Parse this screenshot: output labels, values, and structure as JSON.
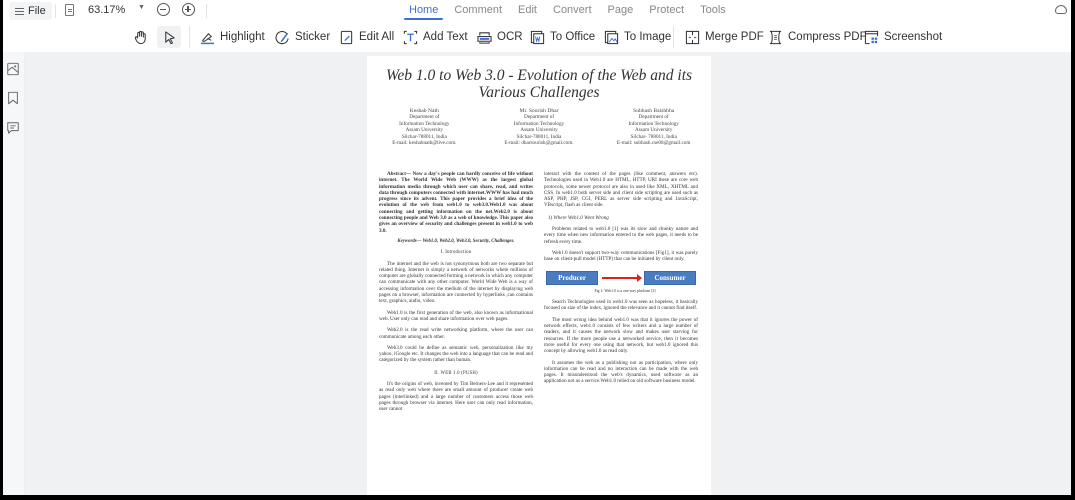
{
  "menubar": {
    "file_label": "File",
    "zoom_level": "63.17%",
    "tabs": [
      {
        "label": "Home",
        "active": true
      },
      {
        "label": "Comment",
        "active": false
      },
      {
        "label": "Edit",
        "active": false
      },
      {
        "label": "Convert",
        "active": false
      },
      {
        "label": "Page",
        "active": false
      },
      {
        "label": "Protect",
        "active": false
      },
      {
        "label": "Tools",
        "active": false
      }
    ],
    "accent_color": "#3d6fd6"
  },
  "toolbar": {
    "highlight": "Highlight",
    "sticker": "Sticker",
    "edit_all": "Edit All",
    "add_text": "Add Text",
    "ocr": "OCR",
    "to_office": "To Office",
    "to_image": "To Image",
    "merge_pdf": "Merge PDF",
    "compress_pdf": "Compress PDF",
    "screenshot": "Screenshot"
  },
  "sidebar": {
    "items": [
      "thumbnails-icon",
      "bookmark-icon",
      "comment-icon"
    ]
  },
  "document": {
    "title": "Web 1.0 to Web 3.0 - Evolution of the Web and its Various Challenges",
    "authors": [
      {
        "name": "Keshab Nath",
        "dept": "Department of",
        "field": "Information Technology",
        "univ": "Assam University",
        "city": "Silchar-788011, India",
        "email": "E-mail: keshabnath@live.com."
      },
      {
        "name": "Mr. Sourish Dhar",
        "dept": "Department of",
        "field": "Information Technology",
        "univ": "Assam University",
        "city": "Silchar-788011, India",
        "email": "E-mail: dharsourish@gmail.com."
      },
      {
        "name": "Subhash Baishbha",
        "dept": "Department of",
        "field": "Information Technology",
        "univ": "Assam University",
        "city": "Silchar- 788011, India",
        "email": "E-mail: subhash.cse08@gmail.com"
      }
    ],
    "abstract": "Abstract— Now a day's people can hardly conceive of life without internet. The World Wide Web (WWW) as the largest global information media through which user can share, read, and writes data through computers connected with internet.WWW has had much progress since its advent. This paper provides a brief idea of the evolution of the web from web1.0 to web3.0.Web1.0 was about connecting and getting information on the net.Web2.0 is about connecting people and Web 3.0 as a web of knowledge. This paper also gives an overview of security and challenges present in web1.0 to web 3.0.",
    "keywords": "Keywords— Web1.0, Web2.0, Web3.0, Security, Challenges.",
    "section1_heading": "I.     Introduction",
    "intro_p1": "The internet and the web is not synonymous both are two separate but related thing. Internet is simply a network of networks where millions of computer are globally connected forming a network in which any computer can communicate with any other computer. World Wide Web is a way of accessing information over the medium of the internet by displaying web pages on a browser, information are connected by hyperlinks ,can contains text, graphics, audio, video.",
    "intro_p2": "Web1.0 is the first generation of the web, also known as informational web. User only can read and share information over web pages.",
    "intro_p3": "Web2.0 is the read write networking platform, where the user can communicate among each other.",
    "intro_p4": "Web3.0 could be define as semantic web, personalization like my yahoo, iGoogle etc. It changes the web into a language that can be read and categorized by the system rather than human.",
    "section2_heading": "II.     WEB 1.0 (PUSH)",
    "web1_p1": "It's the origins of web, invented by Tim Berners-Lee and it represented as read only web where there are small amount of producer create web pages (interlinked) and a large number of customers access those web pages through browser via internet. Here user can only read information, user cannot",
    "right_p1": "interact with the content of the pages (like comment, answers etc). Technologies used in Web1.0 are HTML, HTTP, URI these are core web protocols, some newer protocol are also in used like XML, XHTML and CSS. In web1.0 both server side and client side scripting are used such as ASP, PHP, JSP, CGI, PERL as server side scripting and JavaScript, VBscript, flash as client side.",
    "subsection_heading": "1)   Where Web1.0 Went Wrong",
    "right_p2": "Problems related to web1.0 [1] was its slow and chunky nature and every time when new information entered to the web pages, it needs to be refresh every time.",
    "right_p3": "Web1.0 doesn't support two-way communications [Fig1], it was purely base on client-pull model (HTTP) that can be initiated by client only.",
    "figure": {
      "left_box": "Producer",
      "right_box": "Consumer",
      "caption": "Fig 1: Web1.0 is a one-way platform [3]",
      "box_color": "#4a7cc0",
      "arrow_color": "#e02020"
    },
    "right_p4": "Search Technologies used in web1.0 was seen as hopeless, it basically focused on size of the index, ignored the relevance and it cannot find itself.",
    "right_p5": "The most wrong idea behind web1.0 was that it ignores the power of network effects, web1.0 consists of few writers and a large number of readers, and it causes the network slow and makes user starving for resources. If the more people use a networked service, then it becomes more useful for every one using that network, but web1.0 ignored this concept by allowing web1.0 as read only.",
    "right_p6": "It assumes the web as a publishing not as participation, where only information can be read and no interaction can be made with the web pages. It misunderstood the web's dynamics, used software as an application not as a service.Web1.0 relied on old software business model."
  }
}
